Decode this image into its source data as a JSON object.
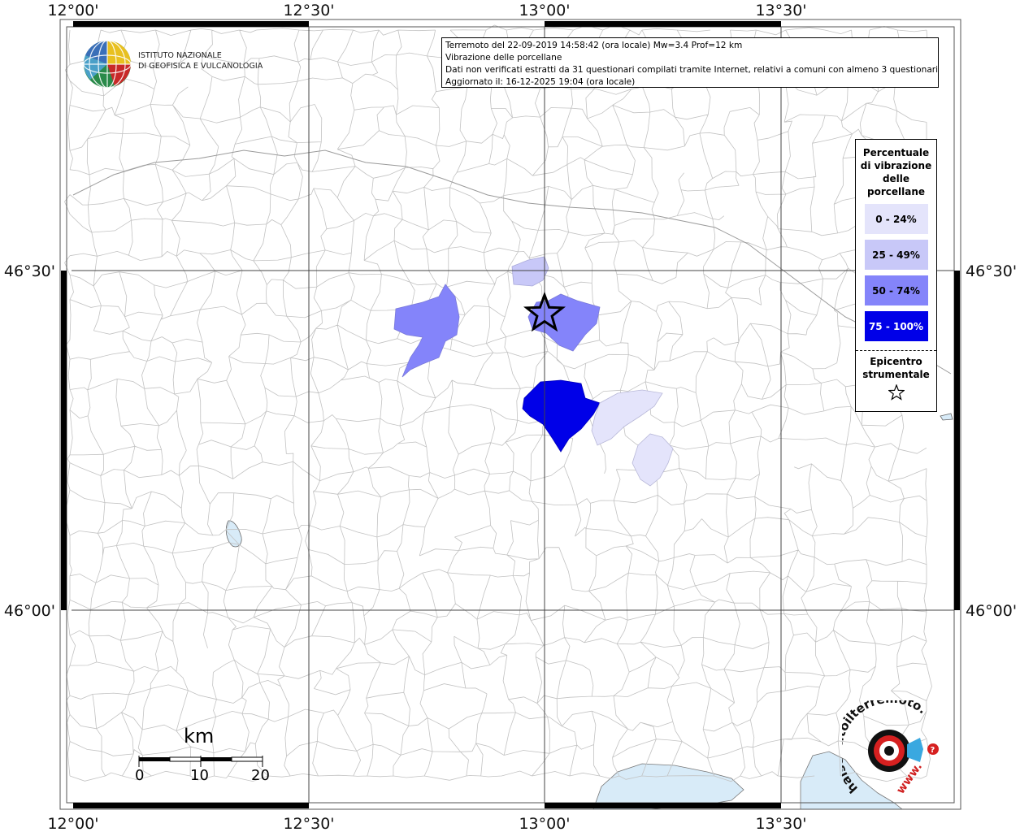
{
  "map": {
    "lon_labels": [
      "12°00'",
      "12°30'",
      "13°00'",
      "13°30'"
    ],
    "lat_labels": [
      "46°30'",
      "46°00'"
    ]
  },
  "info": {
    "line1": "Terremoto del 22-09-2019 14:58:42 (ora locale) Mw=3.4 Prof=12 km",
    "line2": "Vibrazione delle porcellane",
    "line3": "Dati non verificati estratti da 31 questionari compilati tramite Internet, relativi a comuni con almeno 3 questionari.",
    "line4": "Aggiornato il: 16-12-2025 19:04 (ora locale)"
  },
  "legend": {
    "title": "Percentuale\ndi vibrazione\ndelle\nporcellane",
    "items": [
      {
        "label": "0 - 24%",
        "color": "#e4e4fb",
        "text_color": "#000000"
      },
      {
        "label": "25 - 49%",
        "color": "#c8c8f8",
        "text_color": "#000000"
      },
      {
        "label": "50 - 74%",
        "color": "#8484fa",
        "text_color": "#000000"
      },
      {
        "label": "75 - 100%",
        "color": "#0000e8",
        "text_color": "#ffffff"
      }
    ],
    "epicenter_label": "Epicentro\nstrumentale"
  },
  "logo_ingv": {
    "line1": "ISTITUTO NAZIONALE",
    "line2": "DI GEOFISICA E VULCANOLOGIA"
  },
  "scale": {
    "unit": "km",
    "ticks": [
      "0",
      "10",
      "20"
    ]
  },
  "logo_hst": {
    "text": "haisentitoilterremoto.it",
    "prefix": "www."
  }
}
